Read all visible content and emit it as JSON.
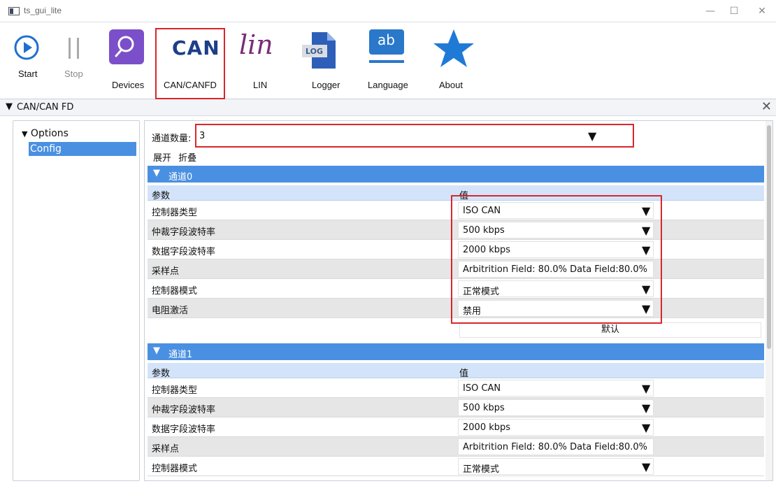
{
  "window": {
    "title": "ts_gui_lite",
    "minimize": "—",
    "maximize": "☐",
    "close": "✕"
  },
  "toolbar": {
    "start": "Start",
    "stop": "Stop",
    "devices": "Devices",
    "can": "CAN/CANFD",
    "can_logo": "CAN",
    "lin": "LIN",
    "lin_logo": "lin",
    "logger": "Logger",
    "logger_logo": "LOG",
    "language": "Language",
    "language_logo": "ab",
    "about": "About"
  },
  "section": {
    "title": "CAN/CAN FD",
    "close": "✕"
  },
  "sidebar": {
    "options": "Options",
    "config": "Config"
  },
  "config": {
    "channel_count_label": "通道数量:",
    "channel_count": "3",
    "expand": "展开",
    "collapse": "折叠",
    "param_header": "参数",
    "value_header": "值",
    "default_button": "默认",
    "channels": [
      {
        "title": "通道0",
        "rows": [
          {
            "name": "控制器类型",
            "value": "ISO CAN",
            "dropdown": true
          },
          {
            "name": "仲裁字段波特率",
            "value": "500 kbps",
            "dropdown": true
          },
          {
            "name": "数据字段波特率",
            "value": "2000 kbps",
            "dropdown": true
          },
          {
            "name": "采样点",
            "value": "Arbitrition Field: 80.0% Data Field:80.0%",
            "dropdown": false
          },
          {
            "name": "控制器模式",
            "value": "正常模式",
            "dropdown": true
          },
          {
            "name": "电阻激活",
            "value": "禁用",
            "dropdown": true
          }
        ]
      },
      {
        "title": "通道1",
        "rows": [
          {
            "name": "控制器类型",
            "value": "ISO CAN",
            "dropdown": true
          },
          {
            "name": "仲裁字段波特率",
            "value": "500 kbps",
            "dropdown": true
          },
          {
            "name": "数据字段波特率",
            "value": "2000 kbps",
            "dropdown": true
          },
          {
            "name": "采样点",
            "value": "Arbitrition Field: 80.0% Data Field:80.0%",
            "dropdown": false
          },
          {
            "name": "控制器模式",
            "value": "正常模式",
            "dropdown": true
          }
        ]
      }
    ]
  },
  "icons": {
    "collapse_triangle": "▼",
    "dropdown_arrow": "▼"
  },
  "colors": {
    "accent": "#4a90e2",
    "highlight_box": "#d9262b",
    "header_row": "#d3e4fa",
    "alt_row": "#e6e6e6"
  }
}
